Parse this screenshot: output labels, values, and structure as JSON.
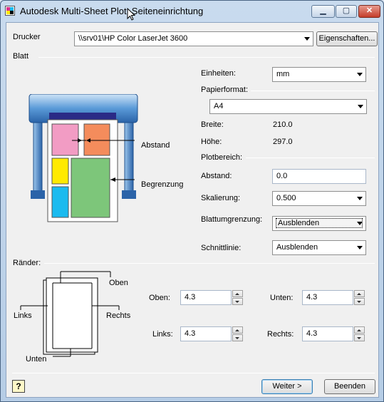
{
  "window": {
    "title": "Autodesk Multi-Sheet Plot: Seiteneinrichtung",
    "minimize_glyph": "▁",
    "maximize_glyph": "▢",
    "close_glyph": "✕"
  },
  "printer": {
    "label": "Drucker",
    "value": "\\\\srv01\\HP Color LaserJet 3600",
    "properties_button": "Eigenschaften..."
  },
  "sheet": {
    "section_label": "Blatt",
    "diagram": {
      "distance_label": "Abstand",
      "limit_label": "Begrenzung"
    },
    "units_label": "Einheiten:",
    "units_value": "mm",
    "paper_format_label": "Papierformat:",
    "paper_format_value": "A4",
    "width_label": "Breite:",
    "width_value": "210.0",
    "height_label": "Höhe:",
    "height_value": "297.0",
    "plot_area_label": "Plotbereich:",
    "distance_label": "Abstand:",
    "distance_value": "0.0",
    "scaling_label": "Skalierung:",
    "scaling_value": "0.500",
    "sheet_limit_label": "Blattumgrenzung:",
    "sheet_limit_value": "Ausblenden",
    "cut_line_label": "Schnittlinie:",
    "cut_line_value": "Ausblenden"
  },
  "margins": {
    "section_label": "Ränder:",
    "diagram": {
      "top": "Oben",
      "left": "Links",
      "right": "Rechts",
      "bottom": "Unten"
    },
    "top_label": "Oben:",
    "top_value": "4.3",
    "bottom_label": "Unten:",
    "bottom_value": "4.3",
    "left_label": "Links:",
    "left_value": "4.3",
    "right_label": "Rechts:",
    "right_value": "4.3"
  },
  "footer": {
    "help_glyph": "?",
    "next_button": "Weiter >",
    "exit_button": "Beenden"
  },
  "colors": {
    "printer_blue": "#3d7bc4",
    "tile_pink": "#f29cc4",
    "tile_orange": "#f48c5c",
    "tile_yellow": "#ffea00",
    "tile_cyan": "#1bbbef",
    "tile_green": "#7dc67a"
  }
}
